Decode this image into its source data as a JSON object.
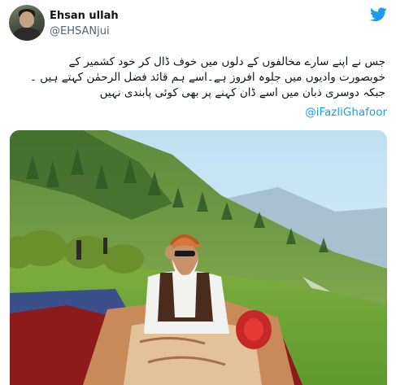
{
  "author": {
    "display_name": "Ehsan ullah",
    "handle": "@EHSANjui"
  },
  "icons": {
    "brand": "twitter-bird-icon",
    "brand_color": "#1d9bf0"
  },
  "tweet": {
    "lines": [
      "جس نے اپنے سارے مخالفوں کے دلوں میں خوف ڈال کر خود کشمیر کے",
      "خوبصورت وادیوں میں جلوہ افروز ہے۔اسے ہم قائد فضل الرحمٰن کہتے ہیں ۔",
      "جبکہ دوسری ذبان میں اسے ڈان کہنے پر بھی کوئی پابندی نہیں"
    ],
    "mention": "@iFazliGhafoor"
  },
  "media": {
    "type": "photo",
    "icon": "photo-image"
  }
}
